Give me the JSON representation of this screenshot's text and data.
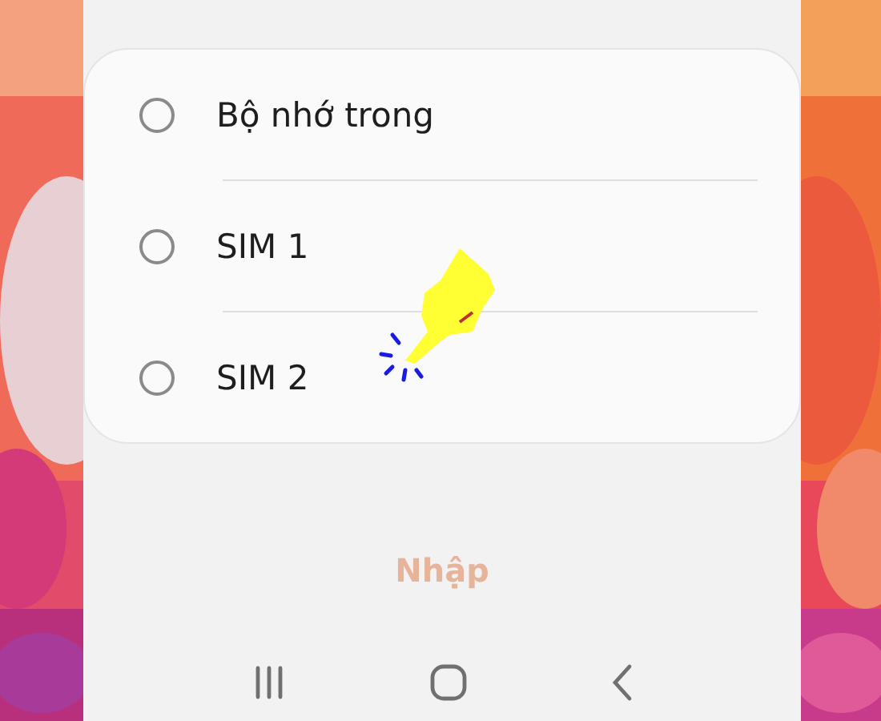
{
  "options": [
    {
      "label": "Bộ nhớ trong",
      "selected": false
    },
    {
      "label": "SIM 1",
      "selected": false
    },
    {
      "label": "SIM 2",
      "selected": false
    }
  ],
  "confirm_button": {
    "label": "Nhập",
    "disabled": true
  }
}
